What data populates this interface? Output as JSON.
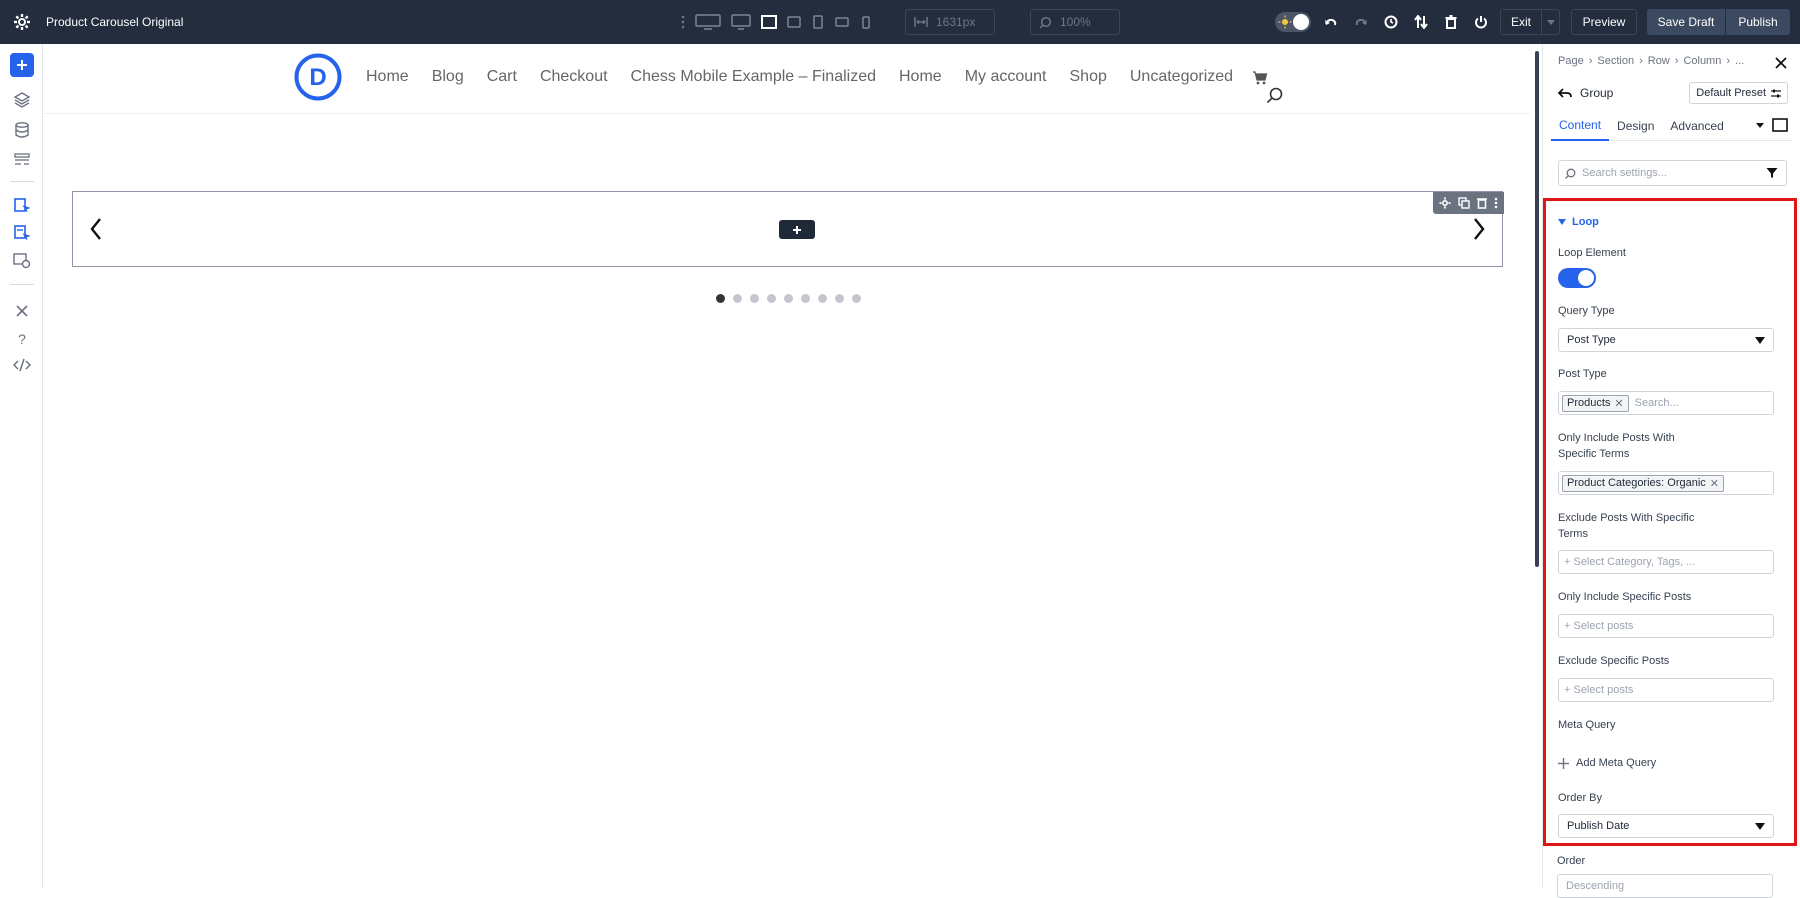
{
  "app": {
    "title": "Product Carousel Original",
    "width_field": "1631px",
    "zoom_field": "100%",
    "exit_label": "Exit",
    "preview_label": "Preview",
    "save_draft_label": "Save Draft",
    "publish_label": "Publish",
    "accent_color": "#2563eb"
  },
  "site": {
    "logo_letter": "D",
    "nav": [
      "Home",
      "Blog",
      "Cart",
      "Checkout",
      "Chess Mobile Example – Finalized",
      "Home",
      "My account",
      "Shop",
      "Uncategorized"
    ]
  },
  "carousel": {
    "dot_count": 9,
    "active_dot": 0
  },
  "panel": {
    "breadcrumb": [
      "Page",
      "›",
      "Section",
      "›",
      "Row",
      "›",
      "Column",
      "›",
      "..."
    ],
    "module_name": "Group",
    "preset_label": "Default Preset",
    "tabs": [
      "Content",
      "Design",
      "Advanced"
    ],
    "search_placeholder": "Search settings...",
    "section_title": "Loop",
    "loop_element_label": "Loop Element",
    "loop_element_enabled": true,
    "query_type_label": "Query Type",
    "query_type_value": "Post Type",
    "post_type_label": "Post Type",
    "post_type_tag": "Products",
    "post_type_search_placeholder": "Search...",
    "include_terms_label_1": "Only Include Posts With",
    "include_terms_label_2": "Specific Terms",
    "include_terms_tag": "Product Categories: Organic",
    "exclude_terms_label_1": "Exclude Posts With Specific",
    "exclude_terms_label_2": "Terms",
    "exclude_terms_placeholder": "+ Select Category, Tags, ...",
    "include_posts_label": "Only Include Specific Posts",
    "include_posts_placeholder": "+ Select posts",
    "exclude_posts_label": "Exclude Specific Posts",
    "exclude_posts_placeholder": "+ Select posts",
    "meta_query_label": "Meta Query",
    "add_meta_query_label": "Add Meta Query",
    "order_by_label": "Order By",
    "order_by_value": "Publish Date",
    "order_label": "Order",
    "order_value": "Descending",
    "highlight_color": "#e01616"
  }
}
